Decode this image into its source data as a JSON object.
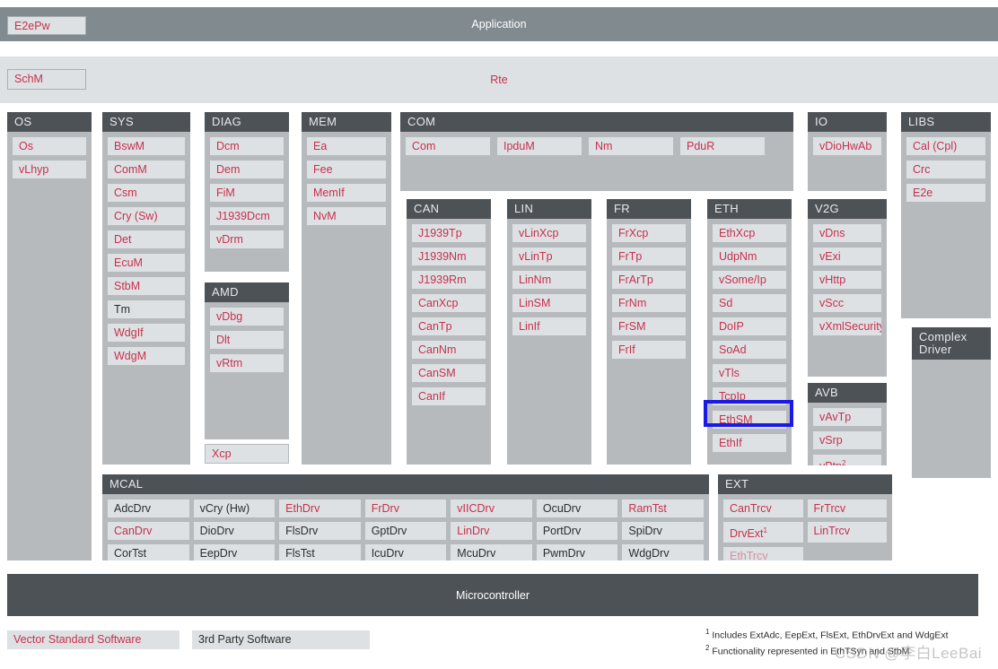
{
  "layers": {
    "application": {
      "title": "Application",
      "chip": "E2ePw"
    },
    "rte": {
      "title": "Rte",
      "chip": "SchM"
    },
    "microcontroller": {
      "title": "Microcontroller"
    }
  },
  "colors": {
    "vector_red": "#c8304c",
    "third_party_black": "#2c2c2c",
    "group_header": "#4d5256",
    "group_body": "#b6babd",
    "module_chip": "#dde1e4",
    "application_bar": "#808a8f",
    "rte_bar": "#dde1e4",
    "highlight_border": "#1a1ae6"
  },
  "groups": {
    "os": {
      "title": "OS",
      "modules": [
        {
          "label": "Os"
        },
        {
          "label": "vLhyp"
        }
      ]
    },
    "sys": {
      "title": "SYS",
      "modules": [
        {
          "label": "BswM"
        },
        {
          "label": "ComM"
        },
        {
          "label": "Csm"
        },
        {
          "label": "Cry (Sw)"
        },
        {
          "label": "Det"
        },
        {
          "label": "EcuM"
        },
        {
          "label": "StbM"
        },
        {
          "label": "Tm",
          "style": "black"
        },
        {
          "label": "WdgIf"
        },
        {
          "label": "WdgM"
        }
      ]
    },
    "diag": {
      "title": "DIAG",
      "modules": [
        {
          "label": "Dcm"
        },
        {
          "label": "Dem"
        },
        {
          "label": "FiM"
        },
        {
          "label": "J1939Dcm"
        },
        {
          "label": "vDrm"
        }
      ]
    },
    "amd": {
      "title": "AMD",
      "modules": [
        {
          "label": "vDbg"
        },
        {
          "label": "Dlt"
        },
        {
          "label": "vRtm"
        }
      ]
    },
    "xcp": {
      "label": "Xcp"
    },
    "mem": {
      "title": "MEM",
      "modules": [
        {
          "label": "Ea"
        },
        {
          "label": "Fee"
        },
        {
          "label": "MemIf"
        },
        {
          "label": "NvM"
        }
      ]
    },
    "com": {
      "title": "COM",
      "modules": [
        {
          "label": "Com"
        },
        {
          "label": "IpduM"
        },
        {
          "label": "Nm"
        },
        {
          "label": "PduR"
        }
      ]
    },
    "can": {
      "title": "CAN",
      "modules": [
        {
          "label": "J1939Tp"
        },
        {
          "label": "J1939Nm"
        },
        {
          "label": "J1939Rm"
        },
        {
          "label": "CanXcp"
        },
        {
          "label": "CanTp"
        },
        {
          "label": "CanNm"
        },
        {
          "label": "CanSM"
        },
        {
          "label": "CanIf"
        }
      ]
    },
    "lin": {
      "title": "LIN",
      "modules": [
        {
          "label": "vLinXcp"
        },
        {
          "label": "vLinTp"
        },
        {
          "label": "LinNm"
        },
        {
          "label": "LinSM"
        },
        {
          "label": "LinIf"
        }
      ]
    },
    "fr": {
      "title": "FR",
      "modules": [
        {
          "label": "FrXcp"
        },
        {
          "label": "FrTp"
        },
        {
          "label": "FrArTp"
        },
        {
          "label": "FrNm"
        },
        {
          "label": "FrSM"
        },
        {
          "label": "FrIf"
        }
      ]
    },
    "eth": {
      "title": "ETH",
      "modules": [
        {
          "label": "EthXcp"
        },
        {
          "label": "UdpNm"
        },
        {
          "label": "vSome/Ip"
        },
        {
          "label": "Sd"
        },
        {
          "label": "DoIP"
        },
        {
          "label": "SoAd"
        },
        {
          "label": "vTls"
        },
        {
          "label": "TcpIp"
        },
        {
          "label": "EthSM"
        },
        {
          "label": "EthIf",
          "highlighted": true
        }
      ]
    },
    "io": {
      "title": "IO",
      "modules": [
        {
          "label": "vDioHwAb"
        }
      ]
    },
    "v2g": {
      "title": "V2G",
      "modules": [
        {
          "label": "vDns"
        },
        {
          "label": "vExi"
        },
        {
          "label": "vHttp"
        },
        {
          "label": "vScc"
        },
        {
          "label": "vXmlSecurity"
        }
      ]
    },
    "avb": {
      "title": "AVB",
      "modules": [
        {
          "label": "vAvTp"
        },
        {
          "label": "vSrp"
        },
        {
          "label": "vPtp",
          "footnote": "2"
        }
      ]
    },
    "libs": {
      "title": "LIBS",
      "modules": [
        {
          "label": "Cal (Cpl)"
        },
        {
          "label": "Crc"
        },
        {
          "label": "E2e"
        }
      ]
    },
    "complex_driver": {
      "title_line1": "Complex",
      "title_line2": "Driver",
      "modules": []
    },
    "mcal": {
      "title": "MCAL",
      "modules": [
        {
          "label": "AdcDrv",
          "style": "black"
        },
        {
          "label": "vCry (Hw)",
          "style": "black"
        },
        {
          "label": "EthDrv"
        },
        {
          "label": "FrDrv"
        },
        {
          "label": "vIICDrv"
        },
        {
          "label": "OcuDrv",
          "style": "black"
        },
        {
          "label": "RamTst"
        },
        {
          "label": "CanDrv"
        },
        {
          "label": "DioDrv",
          "style": "black"
        },
        {
          "label": "FlsDrv",
          "style": "black"
        },
        {
          "label": "GptDrv",
          "style": "black"
        },
        {
          "label": "LinDrv"
        },
        {
          "label": "PortDrv",
          "style": "black"
        },
        {
          "label": "SpiDrv",
          "style": "black"
        },
        {
          "label": "CorTst",
          "style": "black"
        },
        {
          "label": "EepDrv",
          "style": "black"
        },
        {
          "label": "FlsTst",
          "style": "black"
        },
        {
          "label": "IcuDrv",
          "style": "black"
        },
        {
          "label": "McuDrv",
          "style": "black"
        },
        {
          "label": "PwmDrv",
          "style": "black"
        },
        {
          "label": "WdgDrv",
          "style": "black"
        }
      ]
    },
    "ext": {
      "title": "EXT",
      "modules": [
        {
          "label": "CanTrcv"
        },
        {
          "label": "FrTrcv"
        },
        {
          "label": "DrvExt",
          "footnote": "1"
        },
        {
          "label": "LinTrcv"
        },
        {
          "label": "EthTrcv",
          "style": "faded"
        }
      ]
    }
  },
  "legend": {
    "vector": "Vector Standard Software",
    "third_party": "3rd Party Software"
  },
  "footnotes": {
    "one_marker": "1",
    "one": "Includes ExtAdc, EepExt, FlsExt,  EthDrvExt and WdgExt",
    "two_marker": "2",
    "two": "Functionality represented in EthTSyn and StbM"
  },
  "watermark": "CSDN @李白LeeBai"
}
